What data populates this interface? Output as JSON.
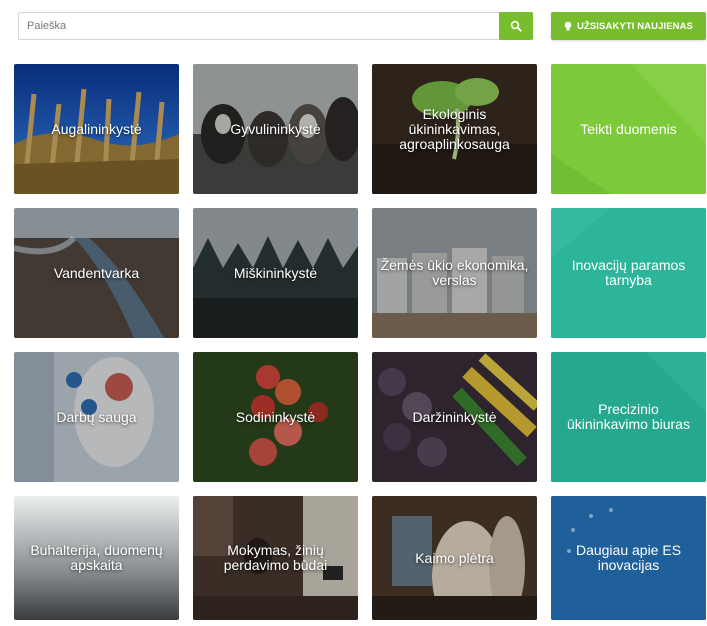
{
  "search": {
    "placeholder": "Paieška",
    "icon": "search-icon"
  },
  "subscribe": {
    "label": "UŽSISAKYTI NAUJIENAS",
    "icon": "lightbulb-icon"
  },
  "colors": {
    "accent": "#77bd2e",
    "teal": "#2cb59a",
    "blue": "#1f5f9a"
  },
  "tiles": [
    "Augalininkystė",
    "Gyvulininkystė",
    "Ekologinis ūkininkavimas, agroaplinkosauga",
    "Teikti duomenis",
    "Vandentvarka",
    "Miškininkystė",
    "Žemės ūkio ekonomika, verslas",
    "Inovacijų paramos tarnyba",
    "Darbų sauga",
    "Sodininkystė",
    "Daržininkystė",
    "Precizinio ūkininkavimo biuras",
    "Buhalterija, duomenų apskaita",
    "Mokymas, žinių perdavimo būdai",
    "Kaimo plėtra",
    "Daugiau apie ES inovacijas"
  ]
}
